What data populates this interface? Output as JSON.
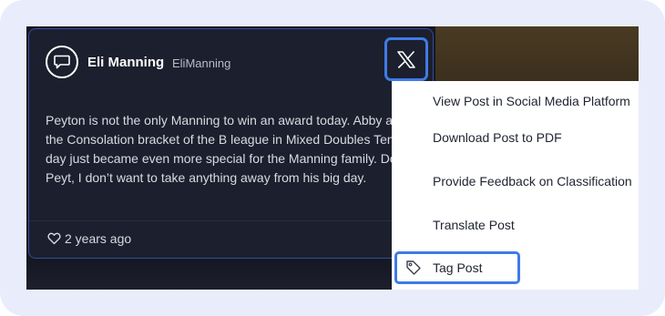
{
  "post": {
    "author_name": "Eli Manning",
    "author_handle": "EliManning",
    "platform_icon": "x-logo-icon",
    "text": "Peyton is not the only Manning to win an award today. Abby and I won the Consolation bracket of the B league in Mixed Doubles Tennis. This day just became even more special for the Manning family. Don’t tell Peyt, I don’t want to take anything away from his big day.",
    "time_ago": "2 years ago"
  },
  "menu": {
    "items": [
      {
        "label": "View Post in Social Media Platform"
      },
      {
        "label": "Download Post to PDF"
      },
      {
        "label": "Provide Feedback on Classification"
      },
      {
        "label": "Translate Post"
      },
      {
        "label": "Tag Post",
        "icon": "tag-icon"
      }
    ]
  },
  "colors": {
    "highlight": "#3f7be8",
    "card_bg": "#1c1f2d",
    "frame_bg": "#e9edfb"
  }
}
